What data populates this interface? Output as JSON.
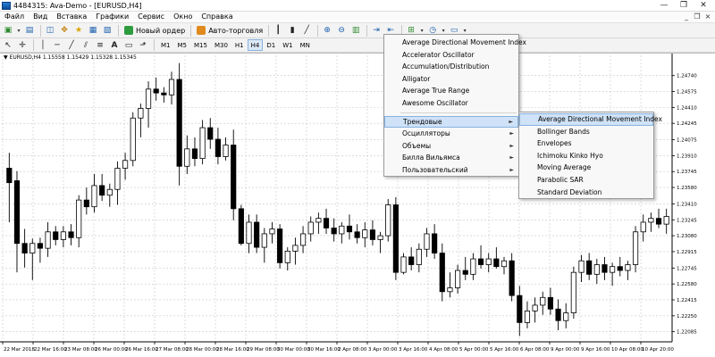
{
  "window": {
    "title": "4484315: Ava-Demo - [EURUSD,H4]",
    "controls": [
      "—",
      "❐",
      "✕"
    ]
  },
  "menubar": {
    "items": [
      "Файл",
      "Вид",
      "Вставка",
      "Графики",
      "Сервис",
      "Окно",
      "Справка"
    ],
    "mdi_controls": [
      "_",
      "❐",
      "×"
    ]
  },
  "toolbar": {
    "new_order_label": "Новый ордер",
    "auto_trading_label": "Авто-торговля"
  },
  "timeframes": [
    "M1",
    "M5",
    "M15",
    "M30",
    "H1",
    "H4",
    "D1",
    "W1",
    "MN"
  ],
  "active_timeframe": "H4",
  "chart": {
    "symbol_label": "▼ EURUSD,H4  1.15558 1.15429 1.15328 1.15345",
    "price_ticks": [
      "1.24740",
      "1.24575",
      "1.24410",
      "1.24245",
      "1.24075",
      "1.23910",
      "1.23745",
      "1.23580",
      "1.23410",
      "1.23245",
      "1.23080",
      "1.22915",
      "1.22745",
      "1.22580",
      "1.22415",
      "1.22250",
      "1.22085"
    ],
    "time_ticks": [
      "22 Mar 2018",
      "22 Mar 16:00",
      "23 Mar 08:00",
      "26 Mar 00:00",
      "26 Mar 16:00",
      "27 Mar 08:00",
      "28 Mar 00:00",
      "28 Mar 16:00",
      "29 Mar 08:00",
      "30 Mar 00:00",
      "30 Mar 16:00",
      "2 Apr 08:00",
      "3 Apr 00:00",
      "3 Apr 16:00",
      "4 Apr 08:00",
      "5 Apr 00:00",
      "5 Apr 16:00",
      "6 Apr 08:00",
      "9 Apr 00:00",
      "9 Apr 16:00",
      "10 Apr 08:00",
      "10 Apr 20:00"
    ],
    "colors": {
      "bull": "#ffffff",
      "bear": "#000000",
      "grid": "#c8c8c8",
      "axis": "#000000"
    }
  },
  "indicators_menu": {
    "items": [
      "Average Directional Movement Index",
      "Accelerator Oscillator",
      "Accumulation/Distribution",
      "Alligator",
      "Average True Range",
      "Awesome Oscillator"
    ],
    "submenus": [
      "Трендовые",
      "Осцилляторы",
      "Объемы",
      "Билла Вильямса",
      "Пользовательский"
    ],
    "highlighted_submenu": "Трендовые"
  },
  "trend_menu": {
    "items": [
      "Average Directional Movement Index",
      "Bollinger Bands",
      "Envelopes",
      "Ichimoku Kinko Hyo",
      "Moving Average",
      "Parabolic SAR",
      "Standard Deviation"
    ],
    "highlighted": "Average Directional Movement Index"
  },
  "chart_data": {
    "type": "candlestick",
    "symbol": "EURUSD",
    "timeframe": "H4",
    "ylim": [
      1.2198,
      1.2495
    ],
    "candles": [
      {
        "o": 1.2378,
        "h": 1.2394,
        "l": 1.2322,
        "c": 1.2363
      },
      {
        "o": 1.2365,
        "h": 1.2375,
        "l": 1.227,
        "c": 1.23
      },
      {
        "o": 1.23,
        "h": 1.2315,
        "l": 1.2275,
        "c": 1.229
      },
      {
        "o": 1.229,
        "h": 1.2305,
        "l": 1.2262,
        "c": 1.23
      },
      {
        "o": 1.23,
        "h": 1.2306,
        "l": 1.228,
        "c": 1.2295
      },
      {
        "o": 1.2295,
        "h": 1.2322,
        "l": 1.2286,
        "c": 1.2312
      },
      {
        "o": 1.2312,
        "h": 1.2318,
        "l": 1.2298,
        "c": 1.2304
      },
      {
        "o": 1.2304,
        "h": 1.2318,
        "l": 1.2296,
        "c": 1.2312
      },
      {
        "o": 1.2312,
        "h": 1.232,
        "l": 1.2298,
        "c": 1.2306
      },
      {
        "o": 1.2306,
        "h": 1.235,
        "l": 1.2296,
        "c": 1.2345
      },
      {
        "o": 1.2345,
        "h": 1.2358,
        "l": 1.233,
        "c": 1.2338
      },
      {
        "o": 1.2338,
        "h": 1.2372,
        "l": 1.2332,
        "c": 1.236
      },
      {
        "o": 1.236,
        "h": 1.2372,
        "l": 1.2344,
        "c": 1.235
      },
      {
        "o": 1.235,
        "h": 1.2362,
        "l": 1.2338,
        "c": 1.2356
      },
      {
        "o": 1.2356,
        "h": 1.2385,
        "l": 1.234,
        "c": 1.2378
      },
      {
        "o": 1.2378,
        "h": 1.2394,
        "l": 1.2366,
        "c": 1.2386
      },
      {
        "o": 1.2386,
        "h": 1.2436,
        "l": 1.238,
        "c": 1.243
      },
      {
        "o": 1.243,
        "h": 1.2445,
        "l": 1.241,
        "c": 1.244
      },
      {
        "o": 1.244,
        "h": 1.2468,
        "l": 1.242,
        "c": 1.246
      },
      {
        "o": 1.246,
        "h": 1.2472,
        "l": 1.2448,
        "c": 1.2456
      },
      {
        "o": 1.2456,
        "h": 1.2462,
        "l": 1.2446,
        "c": 1.2454
      },
      {
        "o": 1.2454,
        "h": 1.2478,
        "l": 1.2444,
        "c": 1.247
      },
      {
        "o": 1.247,
        "h": 1.2487,
        "l": 1.236,
        "c": 1.238
      },
      {
        "o": 1.238,
        "h": 1.2412,
        "l": 1.2372,
        "c": 1.2398
      },
      {
        "o": 1.2398,
        "h": 1.241,
        "l": 1.238,
        "c": 1.2388
      },
      {
        "o": 1.2388,
        "h": 1.2428,
        "l": 1.2382,
        "c": 1.242
      },
      {
        "o": 1.242,
        "h": 1.243,
        "l": 1.2398,
        "c": 1.2408
      },
      {
        "o": 1.2408,
        "h": 1.242,
        "l": 1.2382,
        "c": 1.239
      },
      {
        "o": 1.239,
        "h": 1.241,
        "l": 1.2386,
        "c": 1.2402
      },
      {
        "o": 1.2402,
        "h": 1.2418,
        "l": 1.2324,
        "c": 1.2336
      },
      {
        "o": 1.2336,
        "h": 1.234,
        "l": 1.2298,
        "c": 1.23
      },
      {
        "o": 1.23,
        "h": 1.233,
        "l": 1.229,
        "c": 1.2322
      },
      {
        "o": 1.2322,
        "h": 1.233,
        "l": 1.229,
        "c": 1.2296
      },
      {
        "o": 1.2296,
        "h": 1.2316,
        "l": 1.228,
        "c": 1.231
      },
      {
        "o": 1.231,
        "h": 1.2322,
        "l": 1.23,
        "c": 1.2315
      },
      {
        "o": 1.2315,
        "h": 1.232,
        "l": 1.2274,
        "c": 1.228
      },
      {
        "o": 1.228,
        "h": 1.2296,
        "l": 1.2272,
        "c": 1.2292
      },
      {
        "o": 1.2292,
        "h": 1.2306,
        "l": 1.2278,
        "c": 1.2298
      },
      {
        "o": 1.2298,
        "h": 1.2318,
        "l": 1.229,
        "c": 1.231
      },
      {
        "o": 1.231,
        "h": 1.2328,
        "l": 1.2302,
        "c": 1.2322
      },
      {
        "o": 1.2322,
        "h": 1.2332,
        "l": 1.231,
        "c": 1.2326
      },
      {
        "o": 1.2326,
        "h": 1.2336,
        "l": 1.231,
        "c": 1.2316
      },
      {
        "o": 1.2316,
        "h": 1.2326,
        "l": 1.2302,
        "c": 1.231
      },
      {
        "o": 1.231,
        "h": 1.2322,
        "l": 1.23,
        "c": 1.2318
      },
      {
        "o": 1.2318,
        "h": 1.233,
        "l": 1.2304,
        "c": 1.2312
      },
      {
        "o": 1.2312,
        "h": 1.232,
        "l": 1.23,
        "c": 1.2306
      },
      {
        "o": 1.2306,
        "h": 1.2322,
        "l": 1.2296,
        "c": 1.2314
      },
      {
        "o": 1.2314,
        "h": 1.2324,
        "l": 1.2298,
        "c": 1.2304
      },
      {
        "o": 1.2304,
        "h": 1.2312,
        "l": 1.229,
        "c": 1.2308
      },
      {
        "o": 1.2308,
        "h": 1.2346,
        "l": 1.2302,
        "c": 1.234
      },
      {
        "o": 1.234,
        "h": 1.2348,
        "l": 1.2262,
        "c": 1.227
      },
      {
        "o": 1.227,
        "h": 1.229,
        "l": 1.2268,
        "c": 1.2286
      },
      {
        "o": 1.2286,
        "h": 1.2296,
        "l": 1.2272,
        "c": 1.2278
      },
      {
        "o": 1.2278,
        "h": 1.23,
        "l": 1.227,
        "c": 1.2294
      },
      {
        "o": 1.2294,
        "h": 1.2316,
        "l": 1.2286,
        "c": 1.231
      },
      {
        "o": 1.231,
        "h": 1.232,
        "l": 1.2284,
        "c": 1.229
      },
      {
        "o": 1.229,
        "h": 1.23,
        "l": 1.224,
        "c": 1.225
      },
      {
        "o": 1.225,
        "h": 1.227,
        "l": 1.2244,
        "c": 1.2254
      },
      {
        "o": 1.2254,
        "h": 1.2278,
        "l": 1.2248,
        "c": 1.2272
      },
      {
        "o": 1.2272,
        "h": 1.2286,
        "l": 1.2262,
        "c": 1.2268
      },
      {
        "o": 1.2268,
        "h": 1.229,
        "l": 1.2262,
        "c": 1.2284
      },
      {
        "o": 1.2284,
        "h": 1.2298,
        "l": 1.2274,
        "c": 1.2278
      },
      {
        "o": 1.2278,
        "h": 1.229,
        "l": 1.227,
        "c": 1.2284
      },
      {
        "o": 1.2284,
        "h": 1.2296,
        "l": 1.2274,
        "c": 1.2276
      },
      {
        "o": 1.2276,
        "h": 1.2286,
        "l": 1.2268,
        "c": 1.2282
      },
      {
        "o": 1.2282,
        "h": 1.229,
        "l": 1.224,
        "c": 1.2246
      },
      {
        "o": 1.2246,
        "h": 1.2256,
        "l": 1.2204,
        "c": 1.2218
      },
      {
        "o": 1.2218,
        "h": 1.224,
        "l": 1.2212,
        "c": 1.223
      },
      {
        "o": 1.223,
        "h": 1.2244,
        "l": 1.2218,
        "c": 1.2236
      },
      {
        "o": 1.2236,
        "h": 1.225,
        "l": 1.2226,
        "c": 1.2244
      },
      {
        "o": 1.2244,
        "h": 1.2254,
        "l": 1.2226,
        "c": 1.2232
      },
      {
        "o": 1.2232,
        "h": 1.2242,
        "l": 1.221,
        "c": 1.222
      },
      {
        "o": 1.222,
        "h": 1.2238,
        "l": 1.2212,
        "c": 1.2228
      },
      {
        "o": 1.2228,
        "h": 1.2276,
        "l": 1.2222,
        "c": 1.227
      },
      {
        "o": 1.227,
        "h": 1.2288,
        "l": 1.226,
        "c": 1.2282
      },
      {
        "o": 1.2282,
        "h": 1.229,
        "l": 1.2262,
        "c": 1.2268
      },
      {
        "o": 1.2268,
        "h": 1.2284,
        "l": 1.2258,
        "c": 1.2278
      },
      {
        "o": 1.2278,
        "h": 1.2286,
        "l": 1.2262,
        "c": 1.227
      },
      {
        "o": 1.227,
        "h": 1.228,
        "l": 1.2256,
        "c": 1.2276
      },
      {
        "o": 1.2276,
        "h": 1.2286,
        "l": 1.2266,
        "c": 1.2272
      },
      {
        "o": 1.2272,
        "h": 1.2282,
        "l": 1.2262,
        "c": 1.2278
      },
      {
        "o": 1.2278,
        "h": 1.2318,
        "l": 1.227,
        "c": 1.2312
      },
      {
        "o": 1.2312,
        "h": 1.233,
        "l": 1.2302,
        "c": 1.2322
      },
      {
        "o": 1.2322,
        "h": 1.2332,
        "l": 1.2312,
        "c": 1.2326
      },
      {
        "o": 1.2326,
        "h": 1.2336,
        "l": 1.2316,
        "c": 1.232
      },
      {
        "o": 1.232,
        "h": 1.2336,
        "l": 1.231,
        "c": 1.2328
      }
    ]
  }
}
